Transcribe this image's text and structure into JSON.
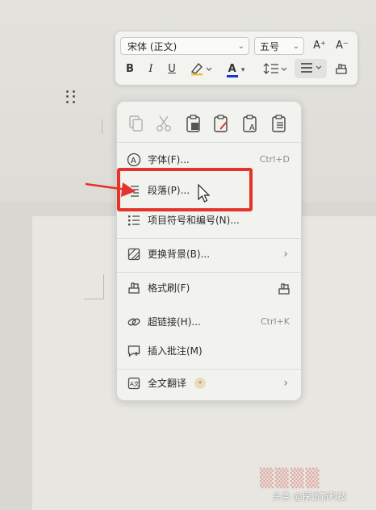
{
  "toolbar": {
    "font_name": "宋体 (正文)",
    "font_size": "五号",
    "grow_font": "A⁺",
    "shrink_font": "A⁻",
    "bold": "B",
    "italic": "I",
    "underline": "U",
    "font_color_letter": "A",
    "font_color": "#2233cc"
  },
  "menu": {
    "items": [
      {
        "label": "字体(F)...",
        "shortcut": "Ctrl+D",
        "icon": "font-a-icon"
      },
      {
        "label": "段落(P)...",
        "shortcut": "",
        "icon": "paragraph-icon"
      },
      {
        "label": "项目符号和编号(N)...",
        "shortcut": "",
        "icon": "list-bullets-icon"
      },
      {
        "label": "更换背景(B)...",
        "shortcut": "",
        "icon": "background-icon",
        "submenu": true
      },
      {
        "label": "格式刷(F)",
        "shortcut": "",
        "icon": "format-painter-icon"
      },
      {
        "label": "超链接(H)...",
        "shortcut": "Ctrl+K",
        "icon": "link-icon"
      },
      {
        "label": "插入批注(M)",
        "shortcut": "",
        "icon": "comment-icon"
      },
      {
        "label": "全文翻译",
        "shortcut": "",
        "icon": "translate-icon",
        "submenu": true
      }
    ],
    "submenu_arrow": "›"
  },
  "colors": {
    "highlight": "#e5322b",
    "menu_bg": "#f2f2ef"
  },
  "watermark": {
    "text": "头条 @探访新科技"
  }
}
